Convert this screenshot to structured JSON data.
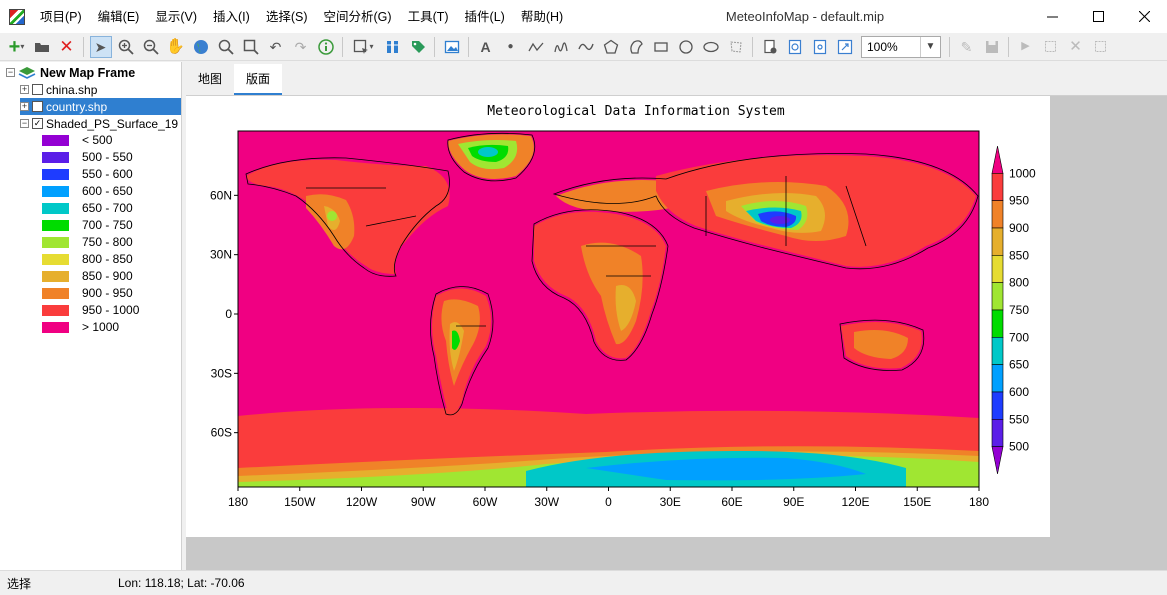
{
  "window": {
    "title": "MeteoInfoMap - default.mip"
  },
  "menu": [
    {
      "label": "项目(P)"
    },
    {
      "label": "编辑(E)"
    },
    {
      "label": "显示(V)"
    },
    {
      "label": "插入(I)"
    },
    {
      "label": "选择(S)"
    },
    {
      "label": "空间分析(G)"
    },
    {
      "label": "工具(T)"
    },
    {
      "label": "插件(L)"
    },
    {
      "label": "帮助(H)"
    }
  ],
  "toolbar": {
    "zoom_value": "100%"
  },
  "tree": {
    "frame": "New Map Frame",
    "layers": [
      {
        "name": "china.shp",
        "checked": false,
        "selected": false
      },
      {
        "name": "country.shp",
        "checked": true,
        "selected": true
      },
      {
        "name": "Shaded_PS_Surface_19",
        "checked": true,
        "selected": false
      }
    ],
    "legend": [
      {
        "label": "< 500",
        "color": "#9400d3"
      },
      {
        "label": "500 - 550",
        "color": "#5b1ee8"
      },
      {
        "label": "550 - 600",
        "color": "#1e3cff"
      },
      {
        "label": "600 - 650",
        "color": "#00a0ff"
      },
      {
        "label": "650 - 700",
        "color": "#00c8c8"
      },
      {
        "label": "700 - 750",
        "color": "#00dc00"
      },
      {
        "label": "750 - 800",
        "color": "#a0e632"
      },
      {
        "label": "800 - 850",
        "color": "#e6dc32"
      },
      {
        "label": "850 - 900",
        "color": "#e6af2d"
      },
      {
        "label": "900 - 950",
        "color": "#f08228"
      },
      {
        "label": "950 - 1000",
        "color": "#fa3c3c"
      },
      {
        "label": "> 1000",
        "color": "#f00082"
      }
    ]
  },
  "tabs": [
    {
      "label": "地图",
      "active": false
    },
    {
      "label": "版面",
      "active": true
    }
  ],
  "map": {
    "title": "Meteorological Data Information System",
    "lon_ticks": [
      "180",
      "150W",
      "120W",
      "90W",
      "60W",
      "30W",
      "0",
      "30E",
      "60E",
      "90E",
      "120E",
      "150E",
      "180"
    ],
    "lat_ticks": [
      "60N",
      "30N",
      "0",
      "30S",
      "60S"
    ],
    "colorbar_labels": [
      "1000",
      "950",
      "900",
      "850",
      "800",
      "750",
      "700",
      "650",
      "600",
      "550",
      "500"
    ]
  },
  "status": {
    "mode": "选择",
    "coords": "Lon: 118.18; Lat: -70.06"
  }
}
